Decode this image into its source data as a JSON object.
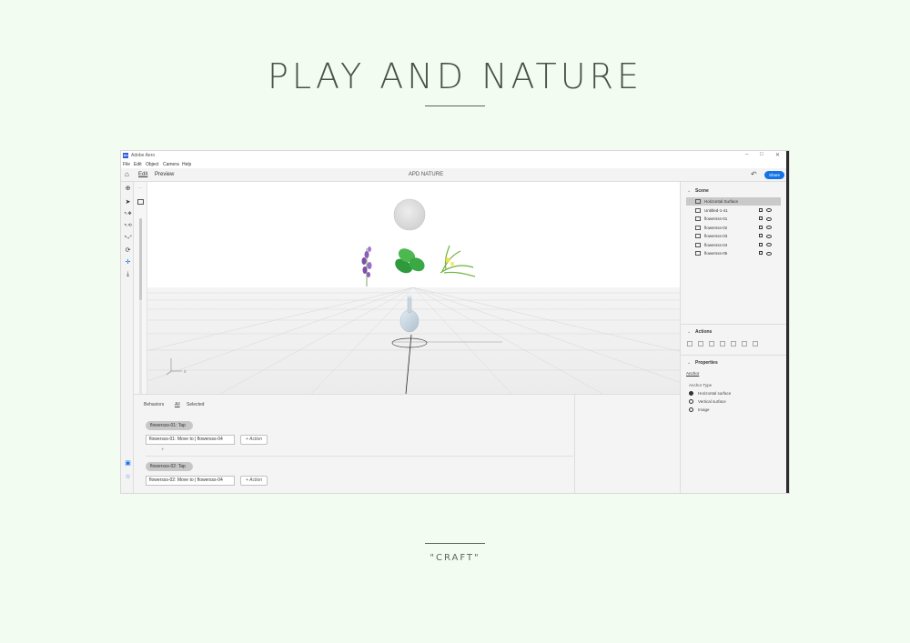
{
  "page": {
    "title": "PLAY AND NATURE",
    "footer": "\"CRAFT\""
  },
  "window": {
    "app_title": "Adobe Aero",
    "logo_letters": "Ae",
    "controls": [
      "–",
      "□",
      "✕"
    ]
  },
  "menu": [
    "File",
    "Edit",
    "Object",
    "Camera",
    "Help"
  ],
  "toolbar": {
    "tabs": [
      "Edit",
      "Preview"
    ],
    "document_title": "APD NATURE",
    "share_label": "Share"
  },
  "viewport": {
    "axis_label": "x"
  },
  "behaviors": {
    "header": "Behaviors",
    "filters": [
      "All",
      "Selected"
    ],
    "blocks": [
      {
        "trigger": "flowersss-01: Tap",
        "action": "flowersss-01: Move to | flowersss-04",
        "add_label": "+ Action"
      },
      {
        "trigger": "flowersss-02: Tap",
        "action": "flowersss-02: Move to | flowersss-04",
        "add_label": "+ Action"
      }
    ],
    "add_symbol": "+"
  },
  "scene": {
    "header": "Scene",
    "items": [
      {
        "name": "Horizontal Surface",
        "selected": true,
        "controls": false
      },
      {
        "name": "Untitled-1-41",
        "selected": false,
        "controls": true
      },
      {
        "name": "flowersss-01",
        "selected": false,
        "controls": true
      },
      {
        "name": "flowersss-02",
        "selected": false,
        "controls": true
      },
      {
        "name": "flowersss-03",
        "selected": false,
        "controls": true
      },
      {
        "name": "flowersss-04",
        "selected": false,
        "controls": true
      },
      {
        "name": "flowersss-05",
        "selected": false,
        "controls": true
      }
    ]
  },
  "actions": {
    "header": "Actions"
  },
  "properties": {
    "header": "Properties",
    "tab": "Anchor",
    "group_label": "Anchor Type",
    "options": [
      {
        "label": "Horizontal surface",
        "selected": true
      },
      {
        "label": "Vertical surface",
        "selected": false
      },
      {
        "label": "Image",
        "selected": false
      }
    ]
  },
  "colors": {
    "page_bg": "#f2fcf1",
    "accent": "#1473e6",
    "title_text": "#4a5247"
  }
}
